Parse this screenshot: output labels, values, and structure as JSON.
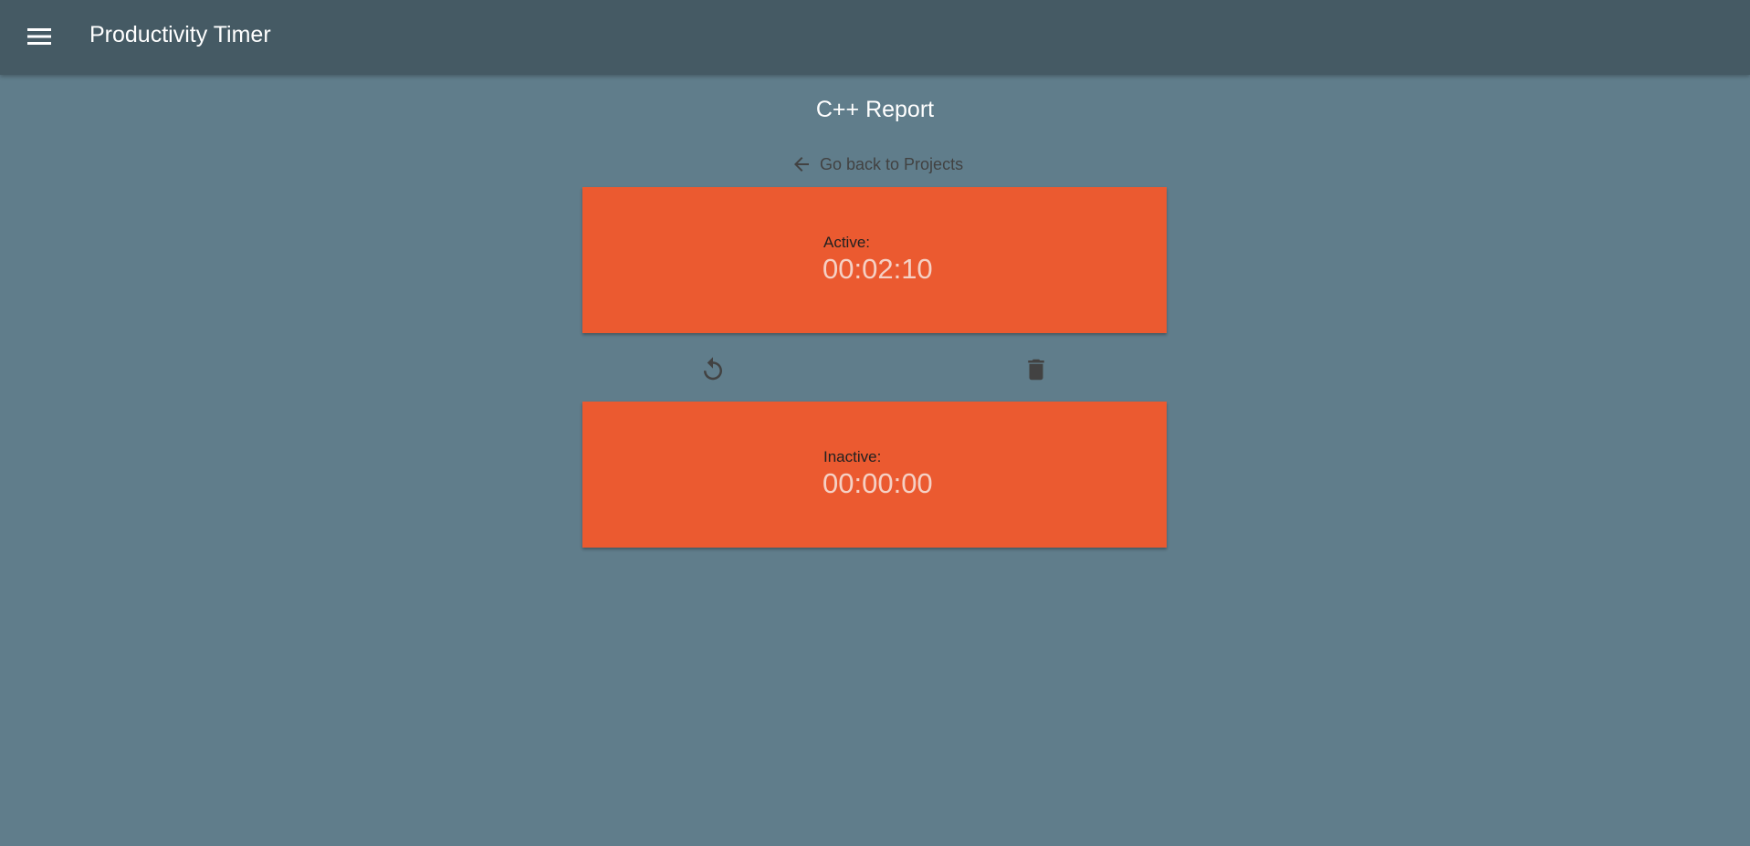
{
  "appbar": {
    "title": "Productivity Timer",
    "menu_icon": "menu-icon"
  },
  "page": {
    "title": "C++ Report",
    "back_link": "Go back to Projects",
    "back_icon": "arrow-left-icon"
  },
  "timers": {
    "active": {
      "label": "Active:",
      "value": "00:02:10"
    },
    "inactive": {
      "label": "Inactive:",
      "value": "00:00:00"
    }
  },
  "actions": {
    "reset_icon": "reset-icon",
    "delete_icon": "trash-icon"
  },
  "colors": {
    "background": "#607d8b",
    "appbar": "#455a64",
    "card": "#eb5a30",
    "icon": "#424242"
  }
}
